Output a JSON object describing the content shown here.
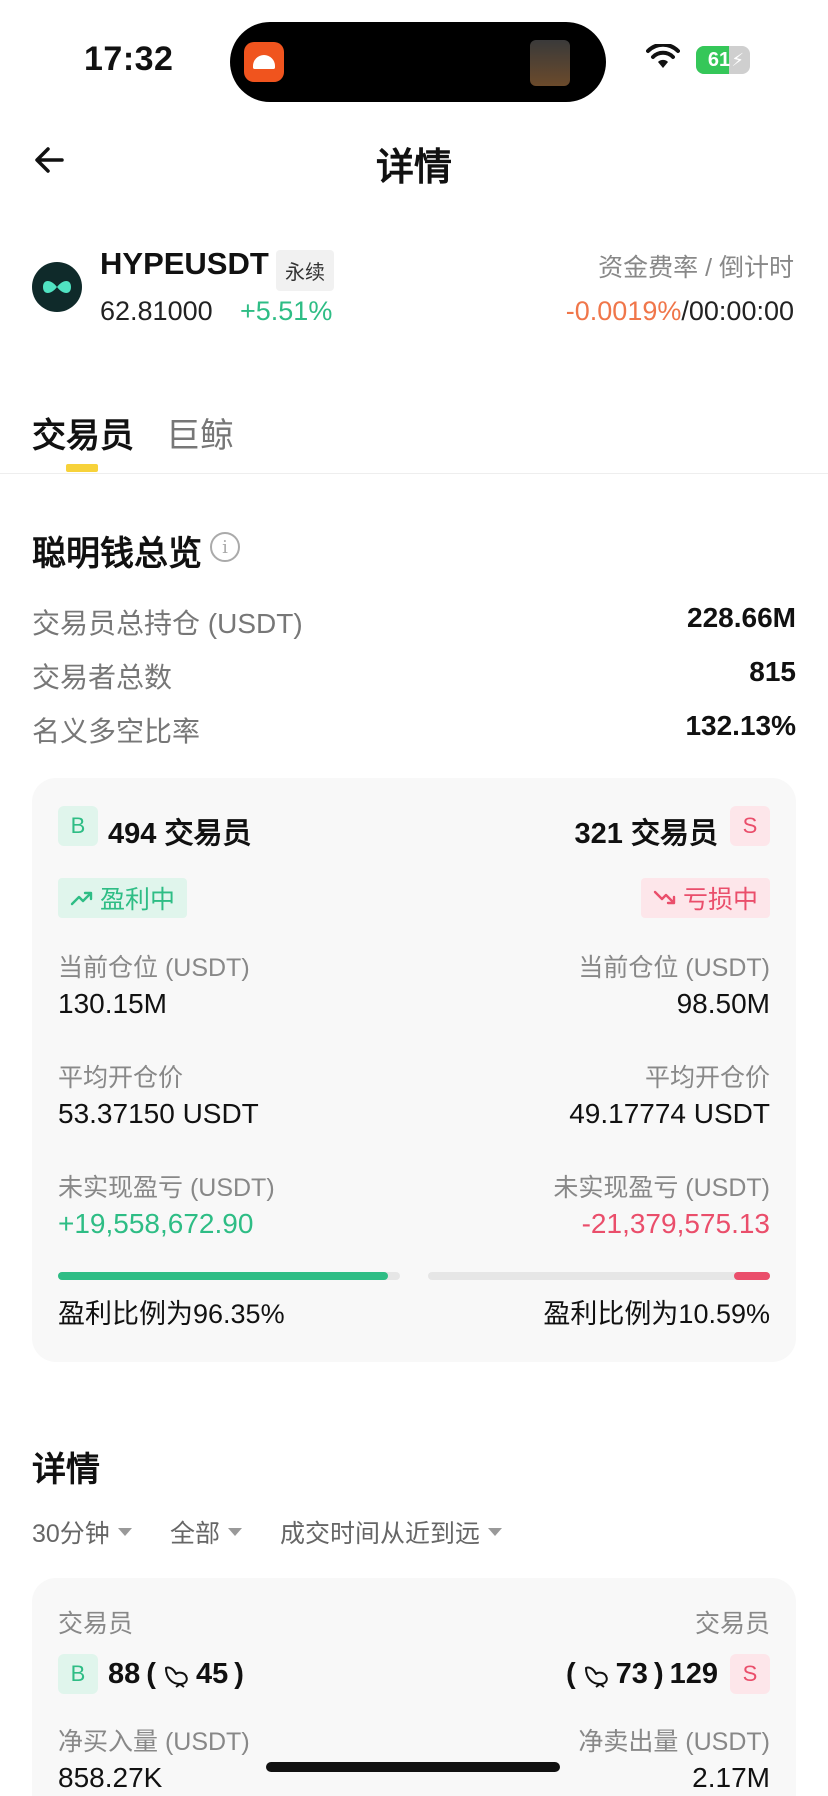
{
  "status_bar": {
    "time": "17:32",
    "battery_level": "61"
  },
  "nav": {
    "title": "详情"
  },
  "ticker": {
    "symbol": "HYPEUSDT",
    "contract_type": "永续",
    "price": "62.81000",
    "change": "+5.51%",
    "funding_label": "资金费率 / 倒计时",
    "funding_rate": "-0.0019%",
    "separator": "/",
    "countdown": "00:00:00"
  },
  "tabs": [
    {
      "label": "交易员",
      "active": true
    },
    {
      "label": "巨鲸",
      "active": false
    }
  ],
  "overview": {
    "title": "聪明钱总览",
    "info_icon": "i",
    "rows": [
      {
        "label": "交易员总持仓 (USDT)",
        "value": "228.66M"
      },
      {
        "label": "交易者总数",
        "value": "815"
      },
      {
        "label": "名义多空比率",
        "value": "132.13%"
      }
    ]
  },
  "long": {
    "badge": "B",
    "count": "494 交易员",
    "status": "盈利中",
    "position_label": "当前仓位 (USDT)",
    "position_value": "130.15M",
    "avg_price_label": "平均开仓价",
    "avg_price_value": "53.37150 USDT",
    "pnl_label": "未实现盈亏 (USDT)",
    "pnl_value": "+19,558,672.90",
    "profit_ratio": 0.9635,
    "ratio_text": "盈利比例为96.35%",
    "color": "#2ebd85"
  },
  "short": {
    "badge": "S",
    "count": "321 交易员",
    "status": "亏损中",
    "position_label": "当前仓位 (USDT)",
    "position_value": "98.50M",
    "avg_price_label": "平均开仓价",
    "avg_price_value": "49.17774 USDT",
    "pnl_label": "未实现盈亏 (USDT)",
    "pnl_value": "-21,379,575.13",
    "profit_ratio": 0.1059,
    "ratio_text": "盈利比例为10.59%",
    "color": "#ea4e6b"
  },
  "details": {
    "title": "详情",
    "filters": [
      "30分钟",
      "全部",
      "成交时间从近到远"
    ],
    "traders_label_left": "交易员",
    "traders_label_right": "交易员",
    "buy_badge": "B",
    "sell_badge": "S",
    "buy_count": "88",
    "buy_whales": "45",
    "sell_whales": "73",
    "sell_count": "129",
    "net_buy_label": "净买入量 (USDT)",
    "net_sell_label": "净卖出量 (USDT)",
    "net_buy_value": "858.27K",
    "net_sell_value": "2.17M"
  }
}
